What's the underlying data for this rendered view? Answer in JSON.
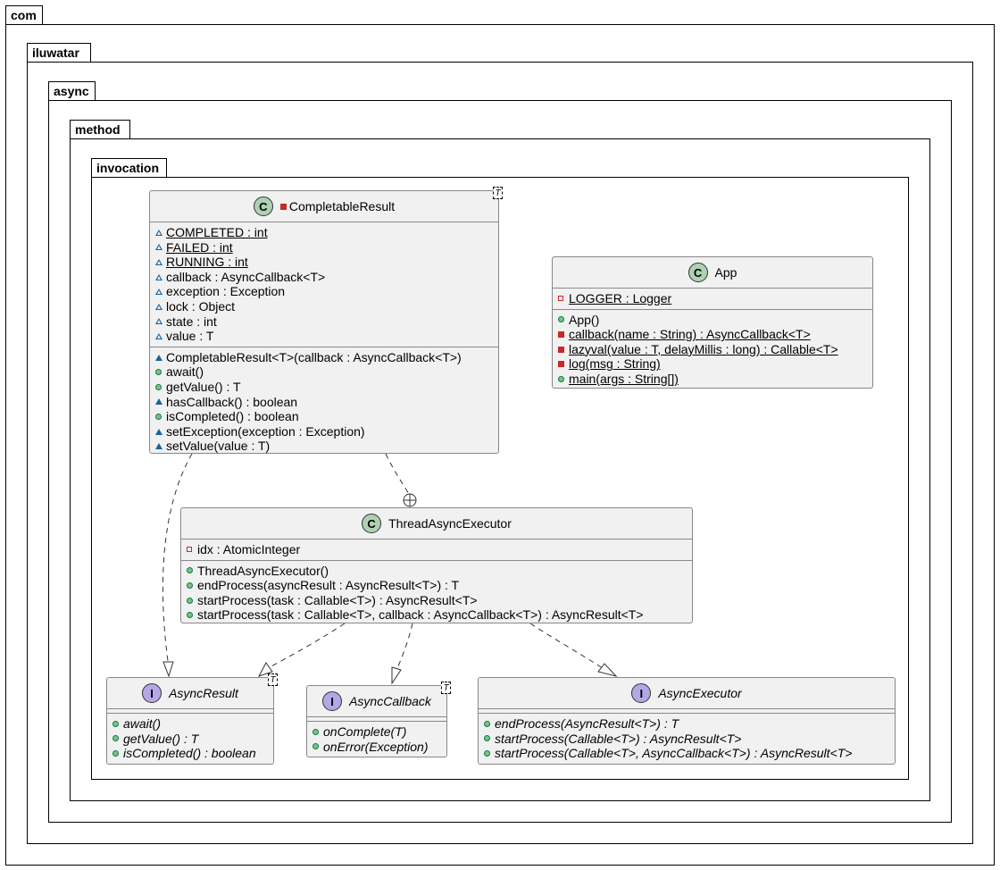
{
  "packages": [
    "com",
    "iluwatar",
    "async",
    "method",
    "invocation"
  ],
  "classes": {
    "completable_result": {
      "stereotype": "C",
      "name": "CompletableResult",
      "type_param": "T",
      "fields": [
        {
          "vis": "pkg-open",
          "text": "COMPLETED : int",
          "static": true
        },
        {
          "vis": "pkg-open",
          "text": "FAILED : int",
          "static": true
        },
        {
          "vis": "pkg-open",
          "text": "RUNNING : int",
          "static": true
        },
        {
          "vis": "pkg-open",
          "text": "callback : AsyncCallback<T>",
          "static": false
        },
        {
          "vis": "pkg-open",
          "text": "exception : Exception",
          "static": false
        },
        {
          "vis": "pkg-open",
          "text": "lock : Object",
          "static": false
        },
        {
          "vis": "pkg-open",
          "text": "state : int",
          "static": false
        },
        {
          "vis": "pkg-open",
          "text": "value : T",
          "static": false
        }
      ],
      "methods": [
        {
          "vis": "pkg-filled",
          "text": "CompletableResult<T>(callback : AsyncCallback<T>)",
          "static": false
        },
        {
          "vis": "public",
          "text": "await()",
          "static": false
        },
        {
          "vis": "public",
          "text": "getValue() : T",
          "static": false
        },
        {
          "vis": "pkg-filled",
          "text": "hasCallback() : boolean",
          "static": false
        },
        {
          "vis": "public",
          "text": "isCompleted() : boolean",
          "static": false
        },
        {
          "vis": "pkg-filled",
          "text": "setException(exception : Exception)",
          "static": false
        },
        {
          "vis": "pkg-filled",
          "text": "setValue(value : T)",
          "static": false
        }
      ]
    },
    "app": {
      "stereotype": "C",
      "name": "App",
      "fields": [
        {
          "vis": "private-open",
          "text": "LOGGER : Logger",
          "static": true
        }
      ],
      "methods": [
        {
          "vis": "public",
          "text": "App()",
          "static": false
        },
        {
          "vis": "private-filled",
          "text": "callback(name : String) : AsyncCallback<T>",
          "static": true
        },
        {
          "vis": "private-filled",
          "text": "lazyval(value : T, delayMillis : long) : Callable<T>",
          "static": true
        },
        {
          "vis": "private-filled",
          "text": "log(msg : String)",
          "static": true
        },
        {
          "vis": "public",
          "text": "main(args : String[])",
          "static": true
        }
      ]
    },
    "thread_async_executor": {
      "stereotype": "C",
      "name": "ThreadAsyncExecutor",
      "fields": [
        {
          "vis": "private-open",
          "text": "idx : AtomicInteger",
          "static": false
        }
      ],
      "methods": [
        {
          "vis": "public",
          "text": "ThreadAsyncExecutor()",
          "static": false
        },
        {
          "vis": "public",
          "text": "endProcess(asyncResult : AsyncResult<T>) : T",
          "static": false
        },
        {
          "vis": "public",
          "text": "startProcess(task : Callable<T>) : AsyncResult<T>",
          "static": false
        },
        {
          "vis": "public",
          "text": "startProcess(task : Callable<T>, callback : AsyncCallback<T>) : AsyncResult<T>",
          "static": false
        }
      ]
    },
    "async_result": {
      "stereotype": "I",
      "name": "AsyncResult",
      "type_param": "T",
      "methods": [
        {
          "vis": "public",
          "text": "await()"
        },
        {
          "vis": "public",
          "text": "getValue() : T"
        },
        {
          "vis": "public",
          "text": "isCompleted() : boolean"
        }
      ]
    },
    "async_callback": {
      "stereotype": "I",
      "name": "AsyncCallback",
      "type_param": "T",
      "methods": [
        {
          "vis": "public",
          "text": "onComplete(T)"
        },
        {
          "vis": "public",
          "text": "onError(Exception)"
        }
      ]
    },
    "async_executor": {
      "stereotype": "I",
      "name": "AsyncExecutor",
      "methods": [
        {
          "vis": "public",
          "text": "endProcess(AsyncResult<T>) : T"
        },
        {
          "vis": "public",
          "text": "startProcess(Callable<T>) : AsyncResult<T>"
        },
        {
          "vis": "public",
          "text": "startProcess(Callable<T>, AsyncCallback<T>) : AsyncResult<T>"
        }
      ]
    }
  },
  "relations": [
    {
      "from": "CompletableResult",
      "to": "AsyncResult",
      "type": "realization"
    },
    {
      "from": "CompletableResult",
      "to": "ThreadAsyncExecutor",
      "type": "nested"
    },
    {
      "from": "ThreadAsyncExecutor",
      "to": "AsyncResult",
      "type": "realization"
    },
    {
      "from": "ThreadAsyncExecutor",
      "to": "AsyncCallback",
      "type": "realization"
    },
    {
      "from": "ThreadAsyncExecutor",
      "to": "AsyncExecutor",
      "type": "realization"
    }
  ]
}
